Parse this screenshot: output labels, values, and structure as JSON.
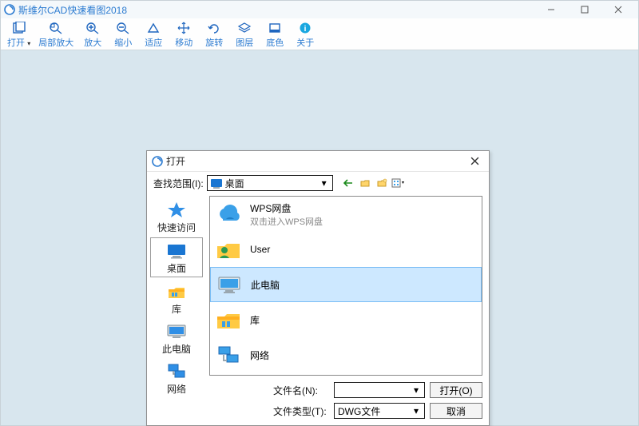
{
  "app": {
    "title": "斯维尔CAD快速看图2018"
  },
  "toolbar": {
    "open": "打开",
    "zoom_area": "局部放大",
    "zoom_in": "放大",
    "zoom_out": "缩小",
    "fit": "适应",
    "move": "移动",
    "rotate": "旋转",
    "layers": "图层",
    "bgcolor": "底色",
    "about": "关于"
  },
  "dialog": {
    "title": "打开",
    "lookin_label": "查找范围(I):",
    "lookin_value": "桌面",
    "places": {
      "quick": "快速访问",
      "desktop": "桌面",
      "libraries": "库",
      "thispc": "此电脑",
      "network": "网络"
    },
    "items": [
      {
        "name": "WPS网盘",
        "sub": "双击进入WPS网盘"
      },
      {
        "name": "User"
      },
      {
        "name": "此电脑"
      },
      {
        "name": "库"
      },
      {
        "name": "网络"
      }
    ],
    "filename_label": "文件名(N):",
    "filename_value": "",
    "filetype_label": "文件类型(T):",
    "filetype_value": "DWG文件",
    "open_btn": "打开(O)",
    "cancel_btn": "取消"
  }
}
